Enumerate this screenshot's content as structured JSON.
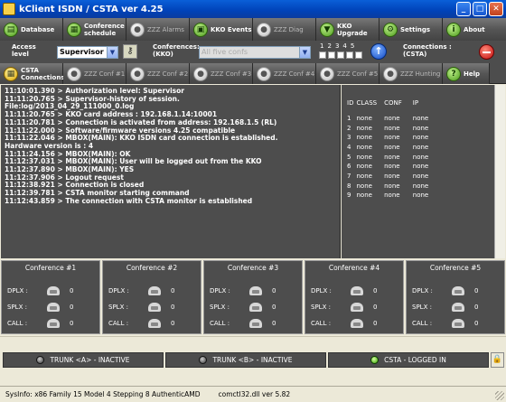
{
  "window": {
    "title": "kClient ISDN / CSTA ver  4.25",
    "buttons": [
      "_",
      "□",
      "✕"
    ]
  },
  "toolbar_top": [
    {
      "label": "Database",
      "icon": "database-icon",
      "enabled": true
    },
    {
      "label": "Conference schedule",
      "icon": "calendar-icon",
      "enabled": true
    },
    {
      "label": "ZZZ Alarms",
      "icon": "alarm-icon",
      "enabled": false
    },
    {
      "label": "KKO Events",
      "icon": "events-icon",
      "enabled": true
    },
    {
      "label": "ZZZ Diag",
      "icon": "diag-icon",
      "enabled": false
    },
    {
      "label": "KKO Upgrade",
      "icon": "upgrade-icon",
      "enabled": true
    },
    {
      "label": "Settings",
      "icon": "settings-icon",
      "enabled": true
    },
    {
      "label": "About",
      "icon": "about-icon",
      "enabled": true
    }
  ],
  "controls": {
    "access_label": "Access level",
    "access_value": "Supervisor",
    "conferences_label": "Conferences: (KKO)",
    "conferences_value": "All five confs",
    "conf_numbers": [
      "1",
      "2",
      "3",
      "4",
      "5"
    ],
    "connections_label": "Connections : (CSTA)"
  },
  "toolbar_tabs": [
    {
      "label": "CSTA Connections",
      "icon": "connections-icon",
      "enabled": true
    },
    {
      "label": "ZZZ Conf #1",
      "icon": "conf-icon",
      "enabled": false
    },
    {
      "label": "ZZZ Conf #2",
      "icon": "conf-icon",
      "enabled": false
    },
    {
      "label": "ZZZ Conf #3",
      "icon": "conf-icon",
      "enabled": false
    },
    {
      "label": "ZZZ Conf #4",
      "icon": "conf-icon",
      "enabled": false
    },
    {
      "label": "ZZZ Conf #5",
      "icon": "conf-icon",
      "enabled": false
    },
    {
      "label": "ZZZ Hunting",
      "icon": "hunting-icon",
      "enabled": false
    },
    {
      "label": "Help",
      "icon": "help-icon",
      "enabled": true
    }
  ],
  "log_lines": [
    "11:10:01.390 > Authorization level: Supervisor",
    "11:11:20.765 > Supervisor-history of session.",
    "File:log/2013_04_29_111000_0.log",
    "11:11:20.765 > KKO card address : 192.168.1.14:10001",
    "11:11:20.781 > Connection is activated from address: 192.168.1.5 (RL)",
    "11:11:22.000 > Software/firmware versions 4.25 compatible",
    "11:11:22.046 > MBOX(MAIN): KKO ISDN card connection is established.",
    "Hardware version is : 4",
    "11:11:24.156 > MBOX(MAIN): OK",
    "11:12:37.031 > MBOX(MAIN): User will be logged out from the KKO",
    "11:12:37.890 > MBOX(MAIN): YES",
    "11:12:37.906 > Logout request",
    "11:12:38.921 > Connection is closed",
    "11:12:39.781 > CSTA monitor starting command",
    "11:12:43.859 > The connection with CSTA monitor is established"
  ],
  "id_table": {
    "headers": [
      "ID",
      "CLASS",
      "CONF",
      "IP"
    ],
    "rows": [
      [
        "1",
        "none",
        "none",
        "none"
      ],
      [
        "2",
        "none",
        "none",
        "none"
      ],
      [
        "3",
        "none",
        "none",
        "none"
      ],
      [
        "4",
        "none",
        "none",
        "none"
      ],
      [
        "5",
        "none",
        "none",
        "none"
      ],
      [
        "6",
        "none",
        "none",
        "none"
      ],
      [
        "7",
        "none",
        "none",
        "none"
      ],
      [
        "8",
        "none",
        "none",
        "none"
      ],
      [
        "9",
        "none",
        "none",
        "none"
      ]
    ]
  },
  "conferences": [
    {
      "title": "Conference #1",
      "dplx": "0",
      "splx": "0",
      "call": "0"
    },
    {
      "title": "Conference #2",
      "dplx": "0",
      "splx": "0",
      "call": "0"
    },
    {
      "title": "Conference #3",
      "dplx": "0",
      "splx": "0",
      "call": "0"
    },
    {
      "title": "Conference #4",
      "dplx": "0",
      "splx": "0",
      "call": "0"
    },
    {
      "title": "Conference #5",
      "dplx": "0",
      "splx": "0",
      "call": "0"
    }
  ],
  "conf_row_labels": {
    "dplx": "DPLX :",
    "splx": "SPLX :",
    "call": "CALL :"
  },
  "trunks": [
    {
      "label": "TRUNK <A> - INACTIVE",
      "status": "off"
    },
    {
      "label": "TRUNK <B> - INACTIVE",
      "status": "off"
    },
    {
      "label": "CSTA - LOGGED IN",
      "status": "on"
    }
  ],
  "sysinfo": {
    "cpu": "SysInfo: x86 Family 15 Model 4 Stepping 8 AuthenticAMD",
    "dll": "comctl32.dll ver 5.82"
  },
  "colors": {
    "panel": "#4d4d4d",
    "titlebar": "#0a5fd8",
    "led_on": "#33a000"
  }
}
